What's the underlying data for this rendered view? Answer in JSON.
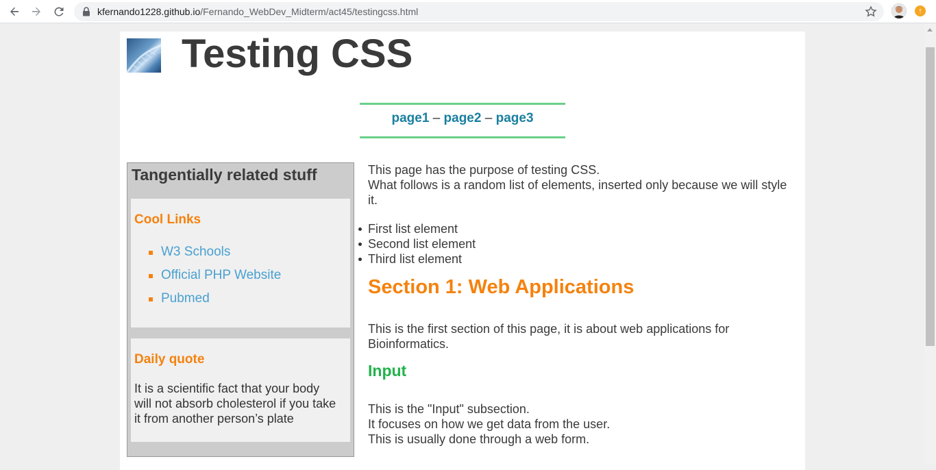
{
  "browser": {
    "url_host": "kfernando1228.github.io",
    "url_path": "/Fernando_WebDev_Midterm/act45/testingcss.html"
  },
  "page": {
    "title": "Testing CSS",
    "nav": {
      "page1": "page1",
      "page2": "page2",
      "page3": "page3",
      "separator": "–"
    },
    "sidebar": {
      "heading": "Tangentially related stuff",
      "cool_links": {
        "heading": "Cool Links",
        "items": [
          "W3 Schools",
          "Official PHP Website",
          "Pubmed"
        ]
      },
      "daily_quote": {
        "heading": "Daily quote",
        "text": "It is a scientific fact that your body will not absorb cholesterol if you take it from another person’s plate"
      }
    },
    "main": {
      "intro_line1": "This page has the purpose of testing CSS.",
      "intro_line2": "What follows is a random list of elements, inserted only because we will style it.",
      "list": [
        "First list element",
        "Second list element",
        "Third list element"
      ],
      "section1_heading": "Section 1: Web Applications",
      "section1_text": "This is the first section of this page, it is about web applications for Bioinformatics.",
      "input_heading": "Input",
      "input_line1": "This is the \"Input\" subsection.",
      "input_line2": "It focuses on how we get data from the user.",
      "input_line3": "This is usually done through a web form."
    }
  },
  "colors": {
    "accent_orange": "#f5820e",
    "link_blue": "#4aa0d0",
    "nav_link": "#1a7fa0",
    "nav_border": "#6ad08a",
    "input_green": "#22b24c"
  },
  "icons": [
    "back-icon",
    "forward-icon",
    "reload-icon",
    "lock-icon",
    "star-icon",
    "avatar",
    "extension-icon"
  ]
}
